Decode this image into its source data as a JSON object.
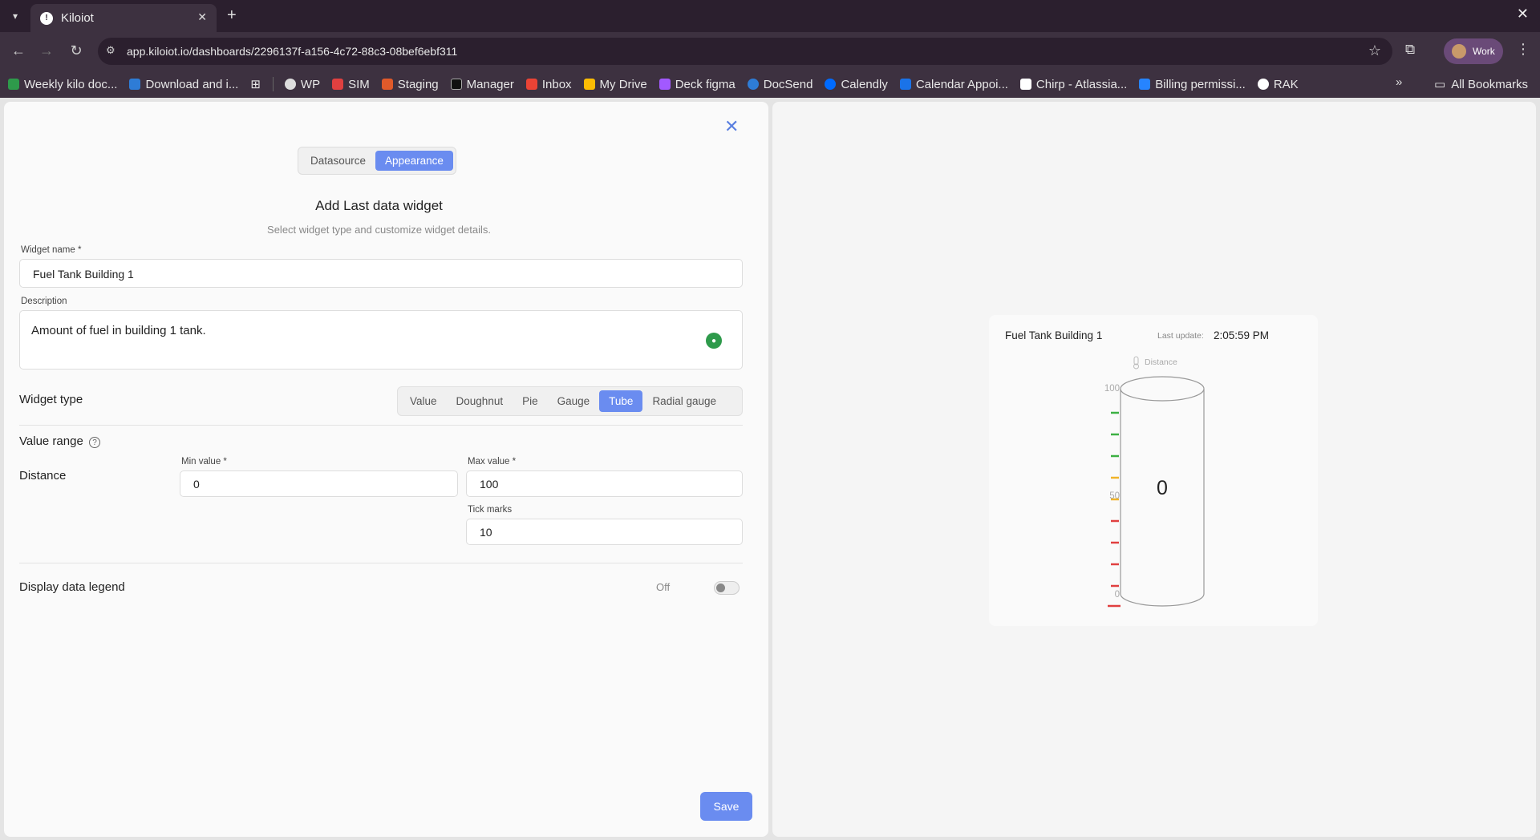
{
  "browser": {
    "tab_title": "Kiloiot",
    "url": "app.kiloiot.io/dashboards/2296137f-a156-4c72-88c3-08bef6ebf311",
    "profile_label": "Work",
    "bookmarks": [
      {
        "label": "Weekly kilo doc...",
        "color": "#2e9a4b"
      },
      {
        "label": "Download and i...",
        "color": "#2e7cd6"
      },
      {
        "label": "WP",
        "color": "#dddddd"
      },
      {
        "label": "SIM",
        "color": "#e04040"
      },
      {
        "label": "Staging",
        "color": "#e05a2a"
      },
      {
        "label": "Manager",
        "color": "#111111"
      },
      {
        "label": "Inbox",
        "color": "#ea4335"
      },
      {
        "label": "My Drive",
        "color": "#fbbc04"
      },
      {
        "label": "Deck figma",
        "color": "#a259ff"
      },
      {
        "label": "DocSend",
        "color": "#2e7cd6"
      },
      {
        "label": "Calendly",
        "color": "#006bff"
      },
      {
        "label": "Calendar Appoi...",
        "color": "#1a73e8"
      },
      {
        "label": "Chirp - Atlassia...",
        "color": "#ffffff"
      },
      {
        "label": "Billing permissi...",
        "color": "#2684ff"
      },
      {
        "label": "RAK",
        "color": "#ffffff"
      }
    ],
    "all_bookmarks": "All Bookmarks"
  },
  "dialog": {
    "tabs": [
      {
        "label": "Datasource",
        "active": false
      },
      {
        "label": "Appearance",
        "active": true
      }
    ],
    "title": "Add Last data widget",
    "subtitle": "Select widget type and customize widget details.",
    "widget_name_label": "Widget name *",
    "widget_name_value": "Fuel Tank Building 1",
    "description_label": "Description",
    "description_value": "Amount of fuel in building 1 tank.",
    "widget_type_label": "Widget type",
    "widget_types": [
      {
        "label": "Value",
        "active": false
      },
      {
        "label": "Doughnut",
        "active": false
      },
      {
        "label": "Pie",
        "active": false
      },
      {
        "label": "Gauge",
        "active": false
      },
      {
        "label": "Tube",
        "active": true
      },
      {
        "label": "Radial gauge",
        "active": false
      }
    ],
    "value_range_label": "Value range",
    "series_label": "Distance",
    "min_label": "Min value *",
    "min_value": "0",
    "max_label": "Max value *",
    "max_value": "100",
    "tick_label": "Tick marks",
    "tick_value": "10",
    "legend_label": "Display data legend",
    "legend_state": "Off",
    "save_label": "Save"
  },
  "preview": {
    "title": "Fuel Tank Building 1",
    "last_update_label": "Last update:",
    "last_update_time": "2:05:59 PM",
    "series_name": "Distance",
    "current_value": "0",
    "axis_labels": [
      "100",
      "50",
      "0"
    ],
    "tick_colors": [
      "#3cb043",
      "#3cb043",
      "#3cb043",
      "#f0b429",
      "#f0b429",
      "#e04040",
      "#e04040",
      "#e04040",
      "#e04040"
    ]
  }
}
